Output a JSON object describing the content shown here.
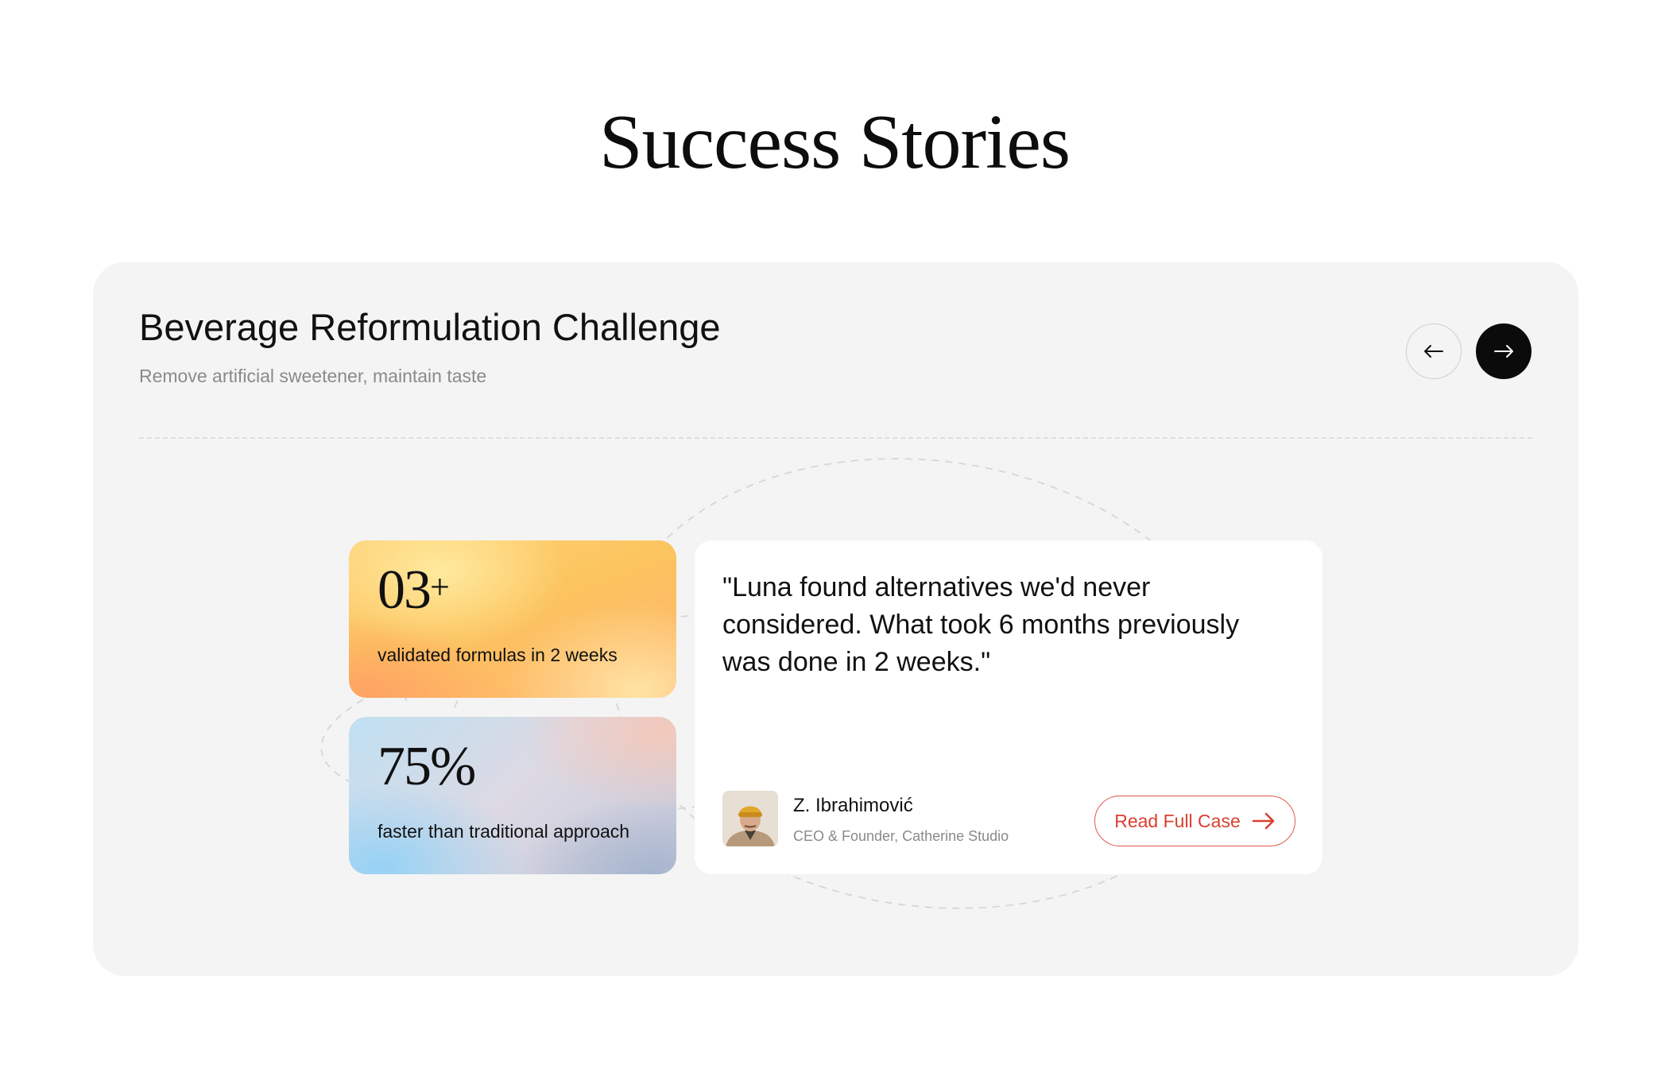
{
  "page": {
    "title": "Success Stories"
  },
  "story": {
    "title": "Beverage Reformulation Challenge",
    "subtitle": "Remove artificial sweetener, maintain taste",
    "nav": {
      "prev_icon": "arrow-left-icon",
      "next_icon": "arrow-right-icon"
    },
    "stats": [
      {
        "value": "03",
        "suffix": "+",
        "label": "validated formulas in 2 weeks",
        "theme": "warm-orange-gradient"
      },
      {
        "value": "75%",
        "suffix": "",
        "label": "faster than traditional approach",
        "theme": "cool-blue-gradient"
      }
    ],
    "quote": {
      "text": "\"Luna found alternatives we'd never considered. What took 6 months previously was done in 2 weeks.\"",
      "author_name": "Z. Ibrahimović",
      "author_role": "CEO & Founder, Catherine Studio",
      "cta_label": "Read Full Case",
      "cta_icon": "arrow-right-icon"
    }
  },
  "colors": {
    "panel_background": "#f4f4f4",
    "next_button": "#0b0b0b",
    "cta_accent": "#d9402f",
    "muted_text": "#8a8a8a"
  }
}
